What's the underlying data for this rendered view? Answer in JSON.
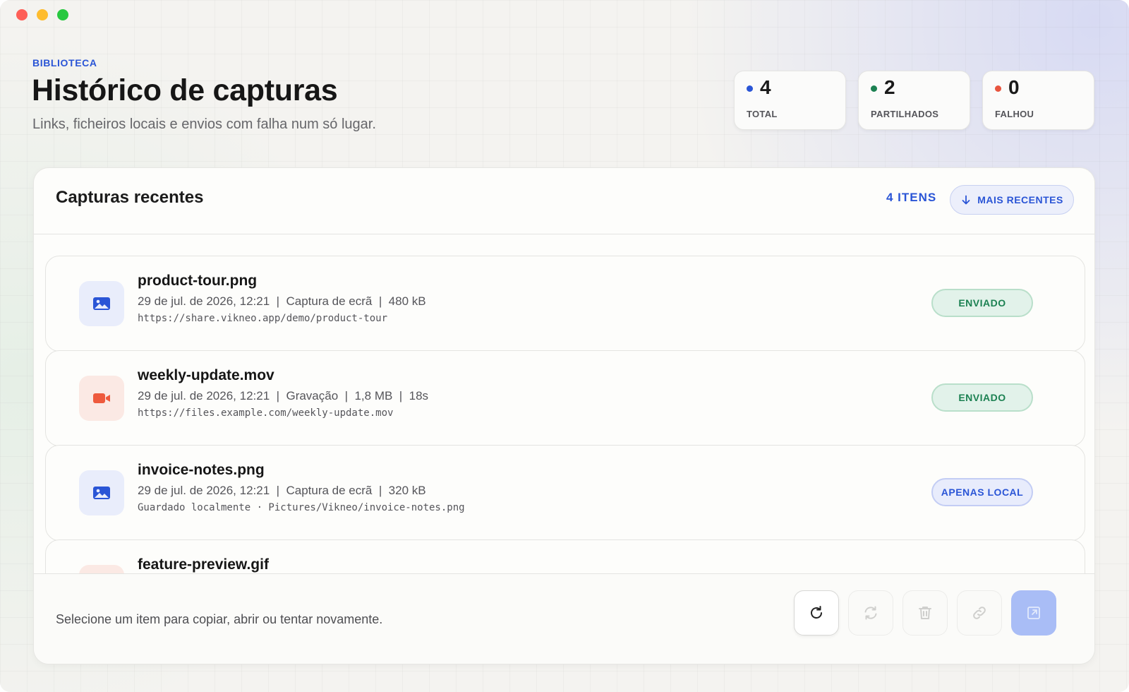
{
  "header": {
    "eyebrow": "BIBLIOTECA",
    "title": "Histórico de capturas",
    "subtitle": "Links, ficheiros locais e envios com falha num só lugar."
  },
  "stats": [
    {
      "value": "4",
      "label": "TOTAL",
      "color": "#2a55d6"
    },
    {
      "value": "2",
      "label": "PARTILHADOS",
      "color": "#1c8152"
    },
    {
      "value": "0",
      "label": "FALHOU",
      "color": "#e8553f"
    }
  ],
  "panel": {
    "title": "Capturas recentes",
    "count": "4 ITENS",
    "sort_label": "MAIS RECENTES"
  },
  "items": [
    {
      "name": "product-tour.png",
      "meta": "29 de jul. de 2026, 12:21  |  Captura de ecrã  |  480 kB",
      "path": "https://share.vikneo.app/demo/product-tour",
      "status": "ENVIADO",
      "icon": "image-icon"
    },
    {
      "name": "weekly-update.mov",
      "meta": "29 de jul. de 2026, 12:21  |  Gravação  |  1,8 MB  |  18s",
      "path": "https://files.example.com/weekly-update.mov",
      "status": "ENVIADO",
      "icon": "video-icon"
    },
    {
      "name": "invoice-notes.png",
      "meta": "29 de jul. de 2026, 12:21  |  Captura de ecrã  |  320 kB",
      "path": "Guardado localmente · Pictures/Vikneo/invoice-notes.png",
      "status": "APENAS LOCAL",
      "icon": "image-icon"
    },
    {
      "name": "feature-preview.gif",
      "icon": "video-icon"
    }
  ],
  "footer": {
    "hint": "Selecione um item para copiar, abrir ou tentar novamente."
  },
  "colors": {
    "accent": "#2a55d6",
    "success": "#1c8152",
    "danger": "#e8553f"
  }
}
